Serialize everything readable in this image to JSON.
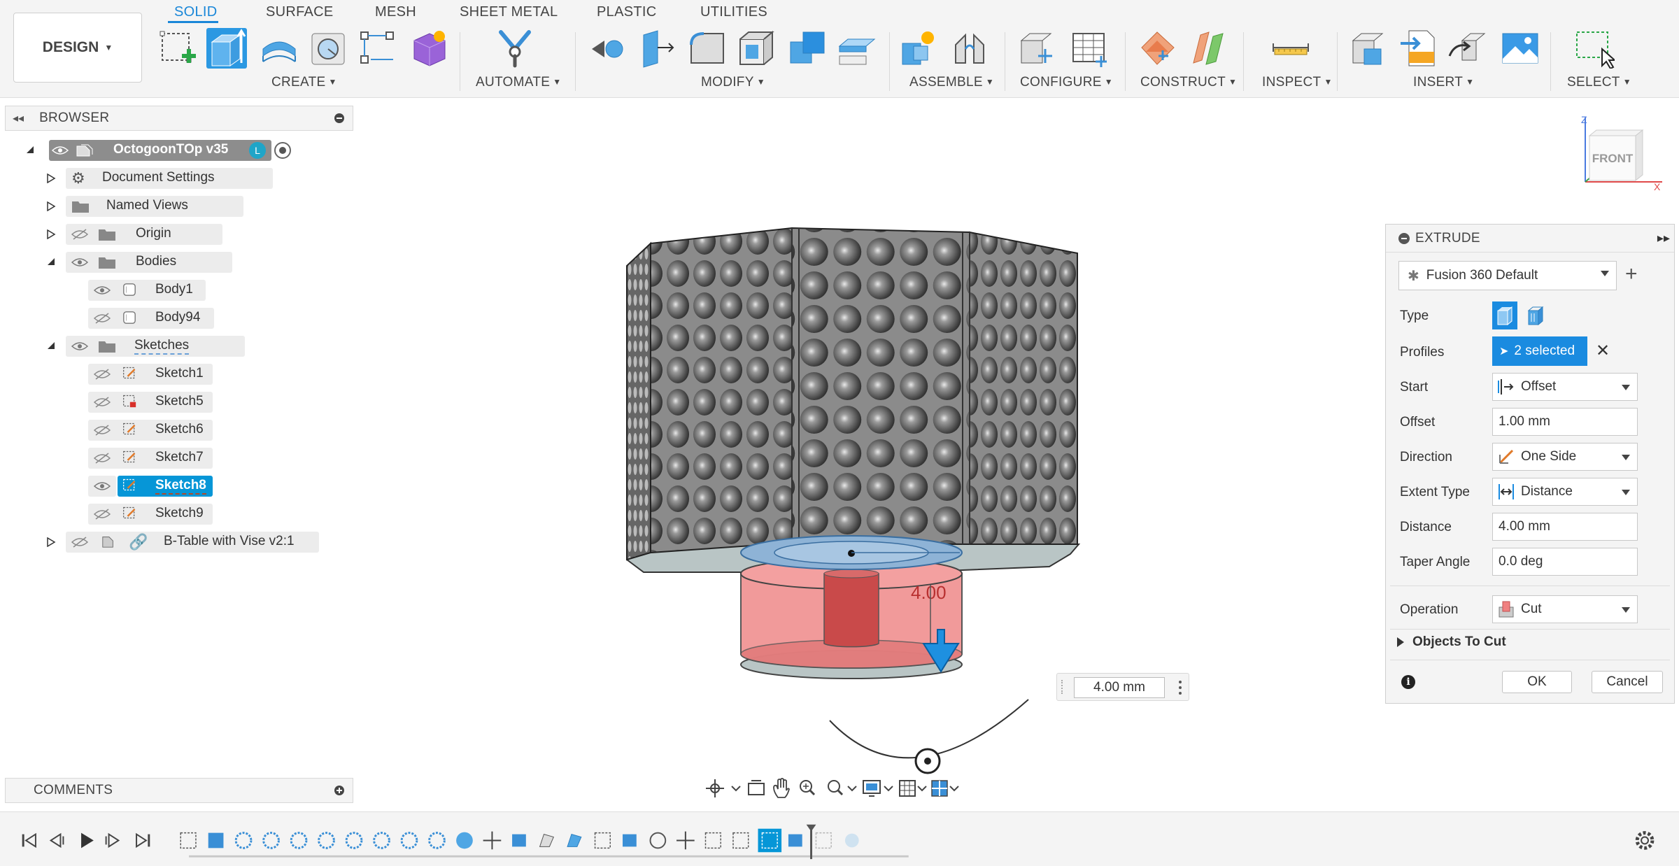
{
  "workspace": {
    "label": "DESIGN"
  },
  "tabs": [
    {
      "label": "SOLID",
      "active": true
    },
    {
      "label": "SURFACE"
    },
    {
      "label": "MESH"
    },
    {
      "label": "SHEET METAL"
    },
    {
      "label": "PLASTIC"
    },
    {
      "label": "UTILITIES"
    }
  ],
  "groups": {
    "create": "CREATE",
    "automate": "AUTOMATE",
    "modify": "MODIFY",
    "assemble": "ASSEMBLE",
    "configure": "CONFIGURE",
    "construct": "CONSTRUCT",
    "inspect": "INSPECT",
    "insert": "INSERT",
    "select": "SELECT"
  },
  "browser": {
    "title": "BROWSER",
    "root": {
      "label": "OctogoonTOp v35",
      "badge": "L"
    },
    "items": {
      "document_settings": "Document Settings",
      "named_views": "Named Views",
      "origin": "Origin",
      "bodies": "Bodies",
      "body1": "Body1",
      "body94": "Body94",
      "sketches": "Sketches",
      "sketch1": "Sketch1",
      "sketch5": "Sketch5",
      "sketch6": "Sketch6",
      "sketch7": "Sketch7",
      "sketch8": "Sketch8",
      "sketch9": "Sketch9",
      "btable": "B-Table with Vise v2:1"
    }
  },
  "comments": {
    "title": "COMMENTS"
  },
  "viewcube": {
    "face": "FRONT",
    "z": "Z",
    "x": "X"
  },
  "viewport": {
    "dimension_label": "4.00",
    "dimension_input": "4.00 mm"
  },
  "extrude": {
    "title": "EXTRUDE",
    "preset": "Fusion 360 Default",
    "labels": {
      "type": "Type",
      "profiles": "Profiles",
      "start": "Start",
      "offset": "Offset",
      "direction": "Direction",
      "extent_type": "Extent Type",
      "distance": "Distance",
      "taper_angle": "Taper Angle",
      "operation": "Operation"
    },
    "profiles_value": "2 selected",
    "start_value": "Offset",
    "offset_value": "1.00 mm",
    "direction_value": "One Side",
    "extent_type_value": "Distance",
    "distance_value": "4.00 mm",
    "taper_angle_value": "0.0 deg",
    "operation_value": "Cut",
    "objects_to_cut": "Objects To Cut",
    "ok": "OK",
    "cancel": "Cancel"
  },
  "colors": {
    "accent": "#1a87d8",
    "selection": "#0696d7",
    "cut_preview": "#f08080"
  }
}
